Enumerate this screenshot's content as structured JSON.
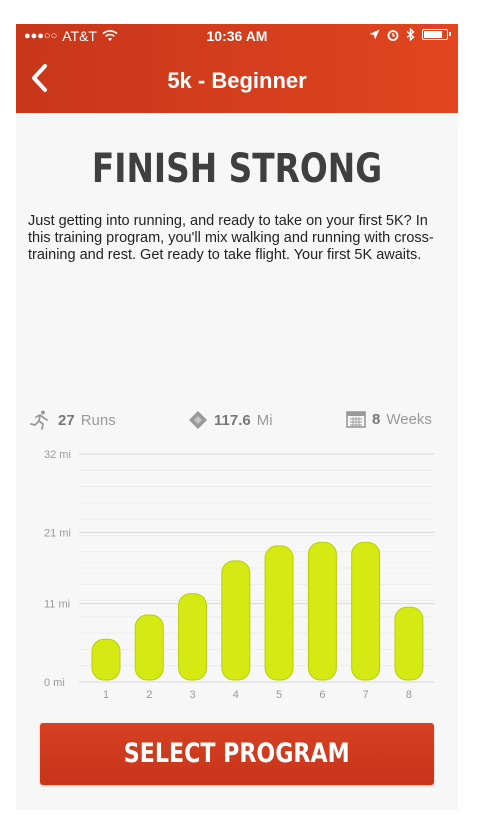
{
  "status_bar": {
    "carrier": "AT&T",
    "time": "10:36 AM",
    "signal_icon": "signal-dots-icon",
    "wifi_icon": "wifi-icon",
    "icons_right": [
      "location-arrow-icon",
      "alarm-icon",
      "bluetooth-icon",
      "battery-icon"
    ]
  },
  "nav": {
    "title": "5k - Beginner",
    "back_icon": "chevron-left-icon"
  },
  "headline": "FINISH STRONG",
  "description": "Just getting into running, and ready to take on your first 5K? In this training program, you'll mix walking and running with cross-training and rest. Get ready to take flight. Your first 5K awaits.",
  "stats": {
    "runs_value": "27",
    "runs_label": "Runs",
    "distance_value": "117.6",
    "distance_label": "Mi",
    "weeks_value": "8",
    "weeks_label": "Weeks"
  },
  "chart_data": {
    "type": "bar",
    "categories": [
      "1",
      "2",
      "3",
      "4",
      "5",
      "6",
      "7",
      "8"
    ],
    "values": [
      6,
      9.4,
      12.4,
      17,
      19.1,
      19.6,
      19.6,
      10.5
    ],
    "ylim": [
      0,
      32
    ],
    "yticks": [
      0,
      11,
      21,
      32
    ],
    "ytick_labels": [
      "0 mi",
      "11 mi",
      "21 mi",
      "32 mi"
    ],
    "xlabel": "",
    "ylabel": "",
    "grid": true,
    "bar_color": "#d4ea12"
  },
  "button": {
    "label": "SELECT PROGRAM"
  },
  "colors": {
    "accent": "#d13c1c",
    "bar": "#d4ea12",
    "text": "#222222"
  }
}
